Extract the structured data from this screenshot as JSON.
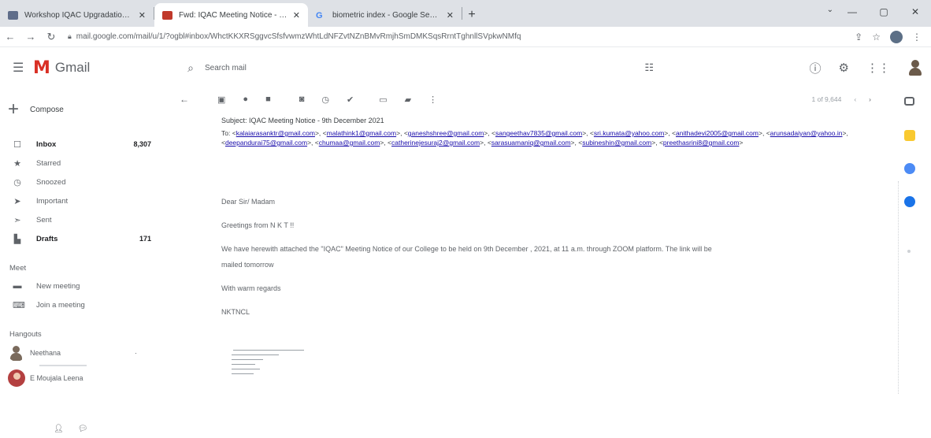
{
  "browser": {
    "tabs": [
      {
        "title": "Workshop IQAC Upgradation Si",
        "fav_color": "#5f6d8a",
        "active": false
      },
      {
        "title": "Fwd: IQAC Meeting Notice - 9th",
        "fav_color": "#c0392b",
        "active": true
      },
      {
        "title": "biometric index - Google Search",
        "fav_color": "#4285f4",
        "active": false
      }
    ],
    "url": "mail.google.com/mail/u/1/?ogbl#inbox/WhctKKXRSggvcSfsfvwmzWhtLdNFZvtNZnBMvRmjhSmDMKSqsRrntTghnllSVpkwNMfq"
  },
  "gmail": {
    "logo_text": "Gmail",
    "search_placeholder": "Search mail",
    "compose_label": "Compose",
    "nav": [
      {
        "label": "Inbox",
        "count": "8,307",
        "icon": "inbox-icon",
        "glyph": "☐",
        "bold": true
      },
      {
        "label": "Starred",
        "count": "",
        "icon": "star-icon",
        "glyph": "★",
        "bold": false
      },
      {
        "label": "Snoozed",
        "count": "",
        "icon": "clock-icon",
        "glyph": "◷",
        "bold": false
      },
      {
        "label": "Important",
        "count": "",
        "icon": "important-icon",
        "glyph": "➤",
        "bold": false
      },
      {
        "label": "Sent",
        "count": "",
        "icon": "send-icon",
        "glyph": "➣",
        "bold": false
      },
      {
        "label": "Drafts",
        "count": "171",
        "icon": "draft-icon",
        "glyph": "▙",
        "bold": true
      }
    ],
    "meet_title": "Meet",
    "meet_items": [
      {
        "label": "New meeting",
        "icon": "video-icon",
        "glyph": "▬"
      },
      {
        "label": "Join a meeting",
        "icon": "keyboard-icon",
        "glyph": "⌨"
      }
    ],
    "hangouts_title": "Hangouts",
    "hangouts": [
      {
        "name": "Neethana",
        "extra": "·"
      },
      {
        "name": "E Moujala Leena",
        "extra": ""
      }
    ]
  },
  "email": {
    "subject_line": "Subject: IQAC Meeting Notice - 9th December 2021",
    "to_label": "To:",
    "recipients": [
      "kalaiarasanktr@gmail.com",
      "malathink1@gmail.com",
      "ganeshshree@gmail.com",
      "sangeethav7835@gmail.com",
      "sri.kumata@yahoo.com",
      "anithadevi2005@gmail.com",
      "arunsadaiyan@yahoo.in",
      "deepandurai75@gmail.com",
      "chumaa@gmail.com",
      "catherinejesuraj2@gmail.com",
      "sarasuamaniq@gmail.com",
      "subineshin@gmail.com",
      "preethasrini8@gmail.com"
    ],
    "greeting": "Dear Sir/ Madam",
    "line1": "Greetings from N K T !!",
    "line2": "We have herewith attached the \"IQAC\" Meeting Notice of our College to be held on 9th December , 2021, at 11 a.m. through ZOOM platform. The link will be",
    "line3": "mailed tomorrow",
    "closing": "With warm regards",
    "signature": "NKTNCL",
    "pager_text": "1 of 9,644"
  }
}
